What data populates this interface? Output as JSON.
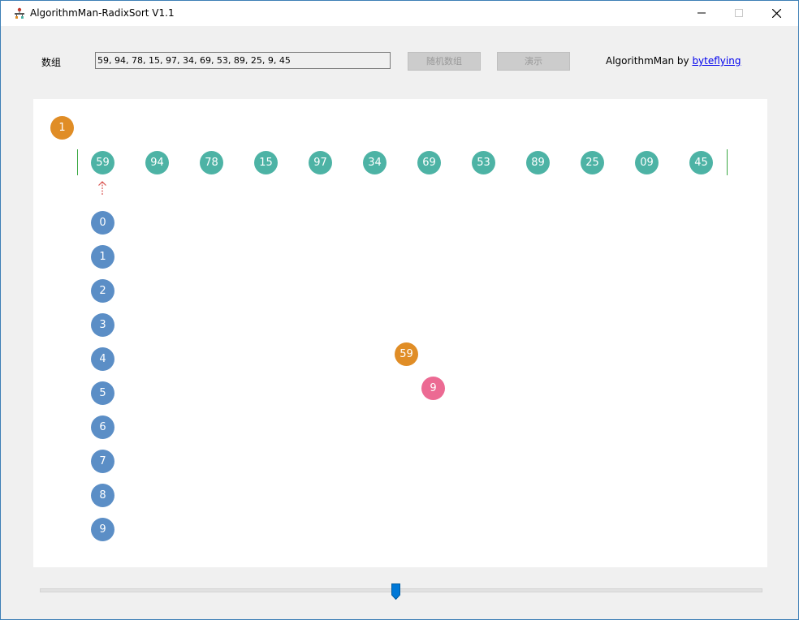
{
  "window": {
    "title": "AlgorithmMan-RadixSort V1.1",
    "icon": "app-logo-icon",
    "controls": [
      "minimize-icon",
      "maximize-icon",
      "close-icon"
    ]
  },
  "toolbar": {
    "array_label": "数组",
    "array_value": "59, 94, 78, 15, 97, 34, 69, 53, 89, 25, 9, 45",
    "random_button": "随机数组",
    "demo_button": "演示",
    "credit_prefix": "AlgorithmMan by ",
    "credit_link": "byteflying"
  },
  "visualization": {
    "pass_digit": "1",
    "array_items": [
      "59",
      "94",
      "78",
      "15",
      "97",
      "34",
      "69",
      "53",
      "89",
      "25",
      "09",
      "45"
    ],
    "buckets": [
      "0",
      "1",
      "2",
      "3",
      "4",
      "5",
      "6",
      "7",
      "8",
      "9"
    ],
    "current_value": "59",
    "current_digit": "9",
    "pointer": "up-arrow-icon",
    "colors": {
      "array_item": "#4db3a5",
      "bucket": "#5b8ec6",
      "highlight": "#e08d26",
      "digit": "#ec6a93",
      "boundary": "#3aa843",
      "pointer": "#d9534f"
    }
  },
  "speed_slider": {
    "value_fraction": 0.49
  }
}
